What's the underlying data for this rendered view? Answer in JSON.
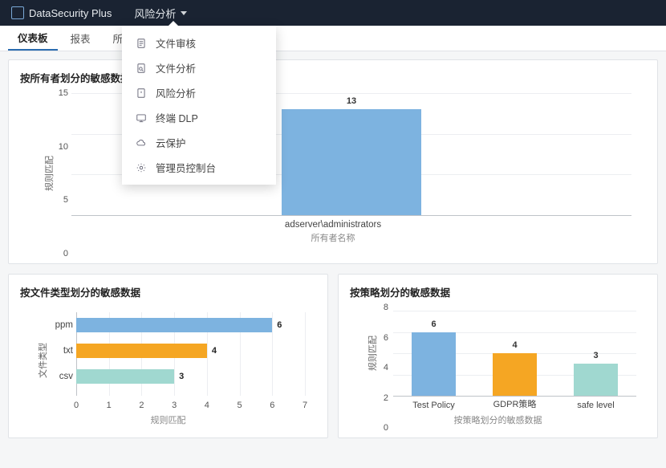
{
  "app": {
    "name": "DataSecurity Plus"
  },
  "nav": {
    "label": "风险分析"
  },
  "tabs": [
    "仪表板",
    "报表",
    "所有权分"
  ],
  "menu": [
    {
      "icon": "file-audit-icon",
      "label": "文件审核"
    },
    {
      "icon": "file-analysis-icon",
      "label": "文件分析"
    },
    {
      "icon": "risk-analysis-icon",
      "label": "风险分析"
    },
    {
      "icon": "endpoint-dlp-icon",
      "label": "终端 DLP"
    },
    {
      "icon": "cloud-protect-icon",
      "label": "云保护"
    },
    {
      "icon": "admin-console-icon",
      "label": "管理员控制台"
    }
  ],
  "cards": {
    "byOwner": {
      "title": "按所有者划分的敏感数据"
    },
    "byType": {
      "title": "按文件类型划分的敏感数据"
    },
    "byPolicy": {
      "title": "按策略划分的敏感数据"
    }
  },
  "colors": {
    "blue": "#7db3e0",
    "orange": "#f5a623",
    "teal": "#a0d8d0"
  },
  "chart_data": [
    {
      "id": "byOwner",
      "type": "bar",
      "orientation": "vertical",
      "categories": [
        "adserver\\administrators"
      ],
      "values": [
        13
      ],
      "title": "按所有者划分的敏感数据",
      "xlabel": "所有者名称",
      "ylabel": "规则匹配",
      "ylim": [
        0,
        15
      ],
      "yticks": [
        0,
        5,
        10,
        15
      ],
      "colors": [
        "#7db3e0"
      ]
    },
    {
      "id": "byType",
      "type": "bar",
      "orientation": "horizontal",
      "categories": [
        "ppm",
        "txt",
        "csv"
      ],
      "values": [
        6,
        4,
        3
      ],
      "title": "按文件类型划分的敏感数据",
      "xlabel": "规则匹配",
      "ylabel": "文件类型",
      "xlim": [
        0,
        7
      ],
      "xticks": [
        0,
        1,
        2,
        3,
        4,
        5,
        6,
        7
      ],
      "colors": [
        "#7db3e0",
        "#f5a623",
        "#a0d8d0"
      ]
    },
    {
      "id": "byPolicy",
      "type": "bar",
      "orientation": "vertical",
      "categories": [
        "Test Policy",
        "GDPR策略",
        "safe level"
      ],
      "values": [
        6,
        4,
        3
      ],
      "title": "按策略划分的敏感数据",
      "xlabel": "按策略划分的敏感数据",
      "ylabel": "规则匹配",
      "ylim": [
        0,
        8
      ],
      "yticks": [
        0,
        2,
        4,
        6,
        8
      ],
      "colors": [
        "#7db3e0",
        "#f5a623",
        "#a0d8d0"
      ]
    }
  ]
}
